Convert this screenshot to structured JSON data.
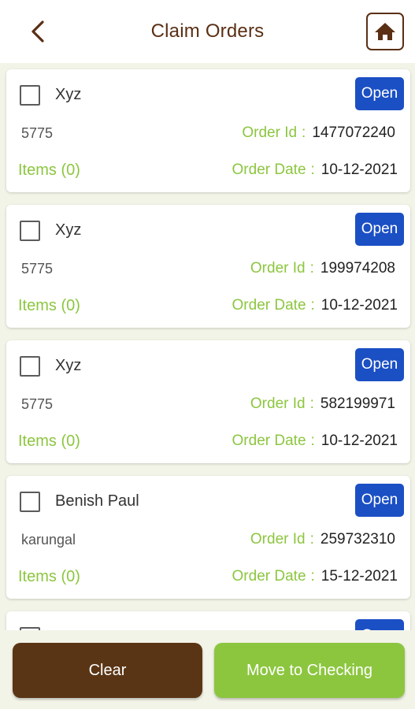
{
  "header": {
    "title": "Claim Orders",
    "back_icon": "chevron-left-icon",
    "home_icon": "home-icon"
  },
  "labels": {
    "order_id": "Order Id",
    "order_date": "Order Date",
    "colon": ":"
  },
  "orders": [
    {
      "name": "Xyz",
      "status": "Open",
      "code": "5775",
      "order_id": "1477072240",
      "items": "Items (0)",
      "order_date": "10-12-2021",
      "checked": false
    },
    {
      "name": "Xyz",
      "status": "Open",
      "code": "5775",
      "order_id": "199974208",
      "items": "Items (0)",
      "order_date": "10-12-2021",
      "checked": false
    },
    {
      "name": "Xyz",
      "status": "Open",
      "code": "5775",
      "order_id": "582199971",
      "items": "Items (0)",
      "order_date": "10-12-2021",
      "checked": false
    },
    {
      "name": "Benish Paul",
      "status": "Open",
      "code": "karungal",
      "order_id": "259732310",
      "items": "Items (0)",
      "order_date": "15-12-2021",
      "checked": false
    }
  ],
  "footer": {
    "clear_label": "Clear",
    "move_label": "Move to Checking"
  },
  "colors": {
    "brown": "#5a3515",
    "green": "#8cc63f",
    "status_blue": "#1b4fc4",
    "background": "#f3f4e8"
  }
}
